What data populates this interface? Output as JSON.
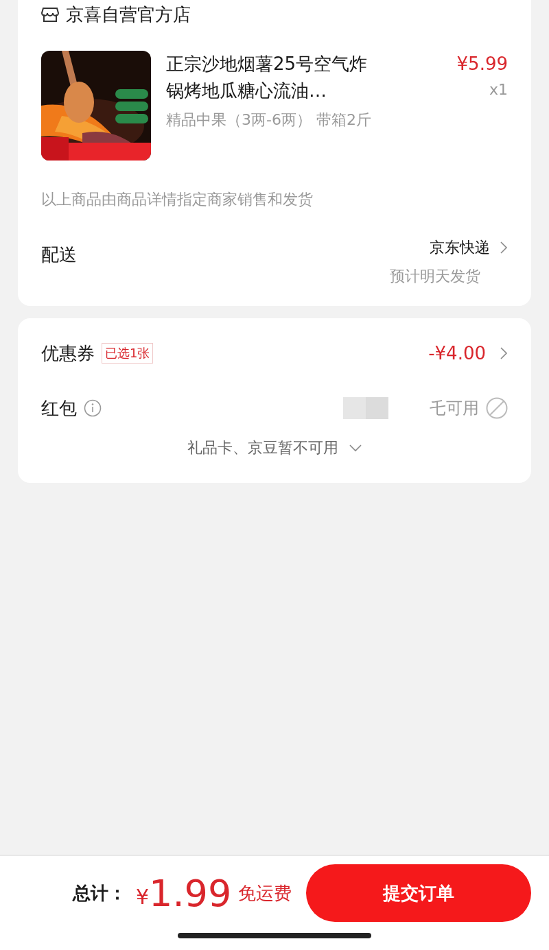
{
  "store": {
    "name": "京喜自营官方店"
  },
  "product": {
    "title": "正宗沙地烟薯25号空气炸锅烤地瓜糖心流油…",
    "spec": "精品中果（3两-6两） 带箱2斤",
    "price": "¥5.99",
    "quantity": "x1"
  },
  "seller_note": "以上商品由商品详情指定商家销售和发货",
  "delivery": {
    "label": "配送",
    "carrier": "京东快递",
    "eta": "预计明天发货"
  },
  "coupon": {
    "label": "优惠券",
    "badge": "已选1张",
    "amount": "-¥4.00"
  },
  "red_packet": {
    "label": "红包",
    "status": "乇可用",
    "disabled": true
  },
  "gift_card_note": "礼品卡、京豆暂不可用",
  "footer": {
    "total_label": "总计：",
    "currency": "¥",
    "total": "1.99",
    "shipping": "免运费",
    "submit": "提交订单"
  }
}
